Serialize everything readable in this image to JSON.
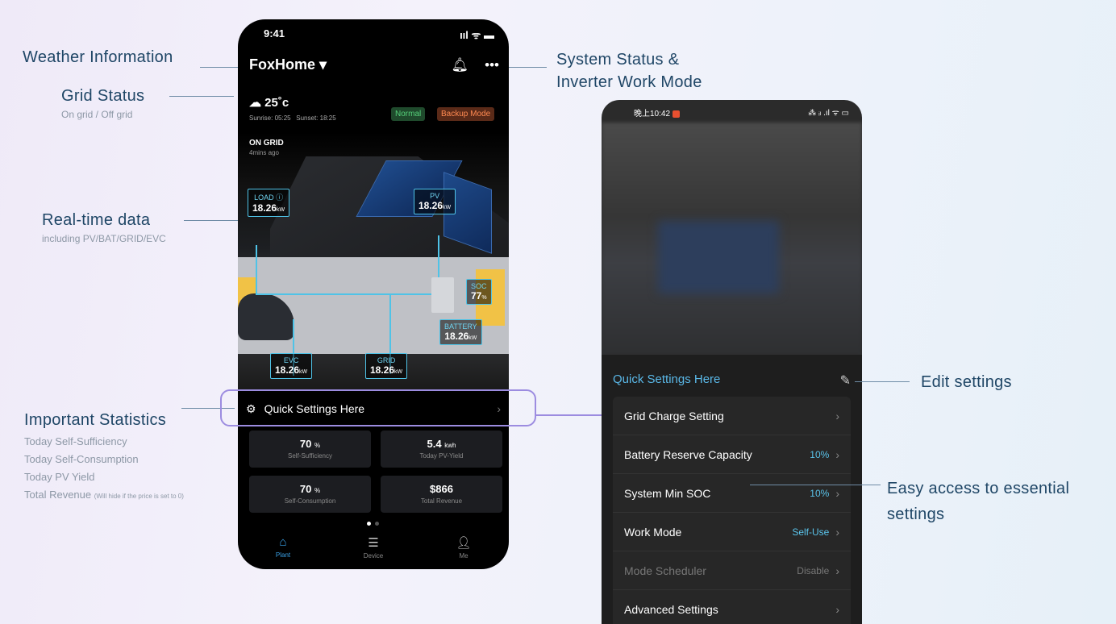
{
  "annotations": {
    "weather": "Weather Information",
    "grid_title": "Grid Status",
    "grid_sub": "On grid / Off grid",
    "realtime_title": "Real-time data",
    "realtime_sub": "including PV/BAT/GRID/EVC",
    "stats_title": "Important Statistics",
    "stats_items": [
      "Today Self-Sufficiency",
      "Today Self-Consumption",
      "Today PV Yield"
    ],
    "stats_last": "Total Revenue",
    "stats_last_note": "(Will hide if the price is set to 0)",
    "system_status": "System Status &",
    "work_mode": "Inverter Work Mode",
    "edit_settings": "Edit settings",
    "easy_access_1": "Easy access to essential",
    "easy_access_2": "settings"
  },
  "phone1": {
    "time": "9:41",
    "signal": "ııl ᯤ ▬",
    "brand": "FoxHome ▾",
    "temp": "25˚c",
    "sunrise": "Sunrise: 05:25",
    "sunset": "Sunset: 18:25",
    "badge_normal": "Normal",
    "badge_backup": "Backup Mode",
    "grid_state": "ON GRID",
    "grid_time": "4mins ago",
    "flows": {
      "load": {
        "label": "LOAD ⓘ",
        "value": "18.26",
        "unit": "kW"
      },
      "pv": {
        "label": "PV",
        "value": "18.26",
        "unit": "kW"
      },
      "soc": {
        "label": "SOC",
        "value": "77",
        "unit": "%"
      },
      "battery": {
        "label": "BATTERY",
        "value": "18.26",
        "unit": "kW"
      },
      "evc": {
        "label": "EVC",
        "value": "18.26",
        "unit": "kW"
      },
      "grid": {
        "label": "GRID",
        "value": "18.26",
        "unit": "kW"
      }
    },
    "quick_settings": "Quick Settings Here",
    "stats": [
      {
        "value": "70",
        "unit": "%",
        "label": "Self-Sufficiency"
      },
      {
        "value": "5.4",
        "unit": "kwh",
        "label": "Today PV-Yield"
      },
      {
        "value": "70",
        "unit": "%",
        "label": "Self-Consumption"
      },
      {
        "value": "$866",
        "unit": "",
        "label": "Total Revenue"
      }
    ],
    "tabs": [
      "Plant",
      "Device",
      "Me"
    ]
  },
  "phone2": {
    "time": "晚上10:42",
    "status_icons": "⁂ ᵢₗ .ıl ᯤ ▭",
    "sheet_title": "Quick Settings Here",
    "items": [
      {
        "label": "Grid Charge Setting",
        "value": ""
      },
      {
        "label": "Battery Reserve Capacity",
        "value": "10%"
      },
      {
        "label": "System Min SOC",
        "value": "10%"
      },
      {
        "label": "Work Mode",
        "value": "Self-Use"
      },
      {
        "label": "Mode Scheduler",
        "value": "Disable"
      },
      {
        "label": "Advanced Settings",
        "value": ""
      }
    ]
  }
}
